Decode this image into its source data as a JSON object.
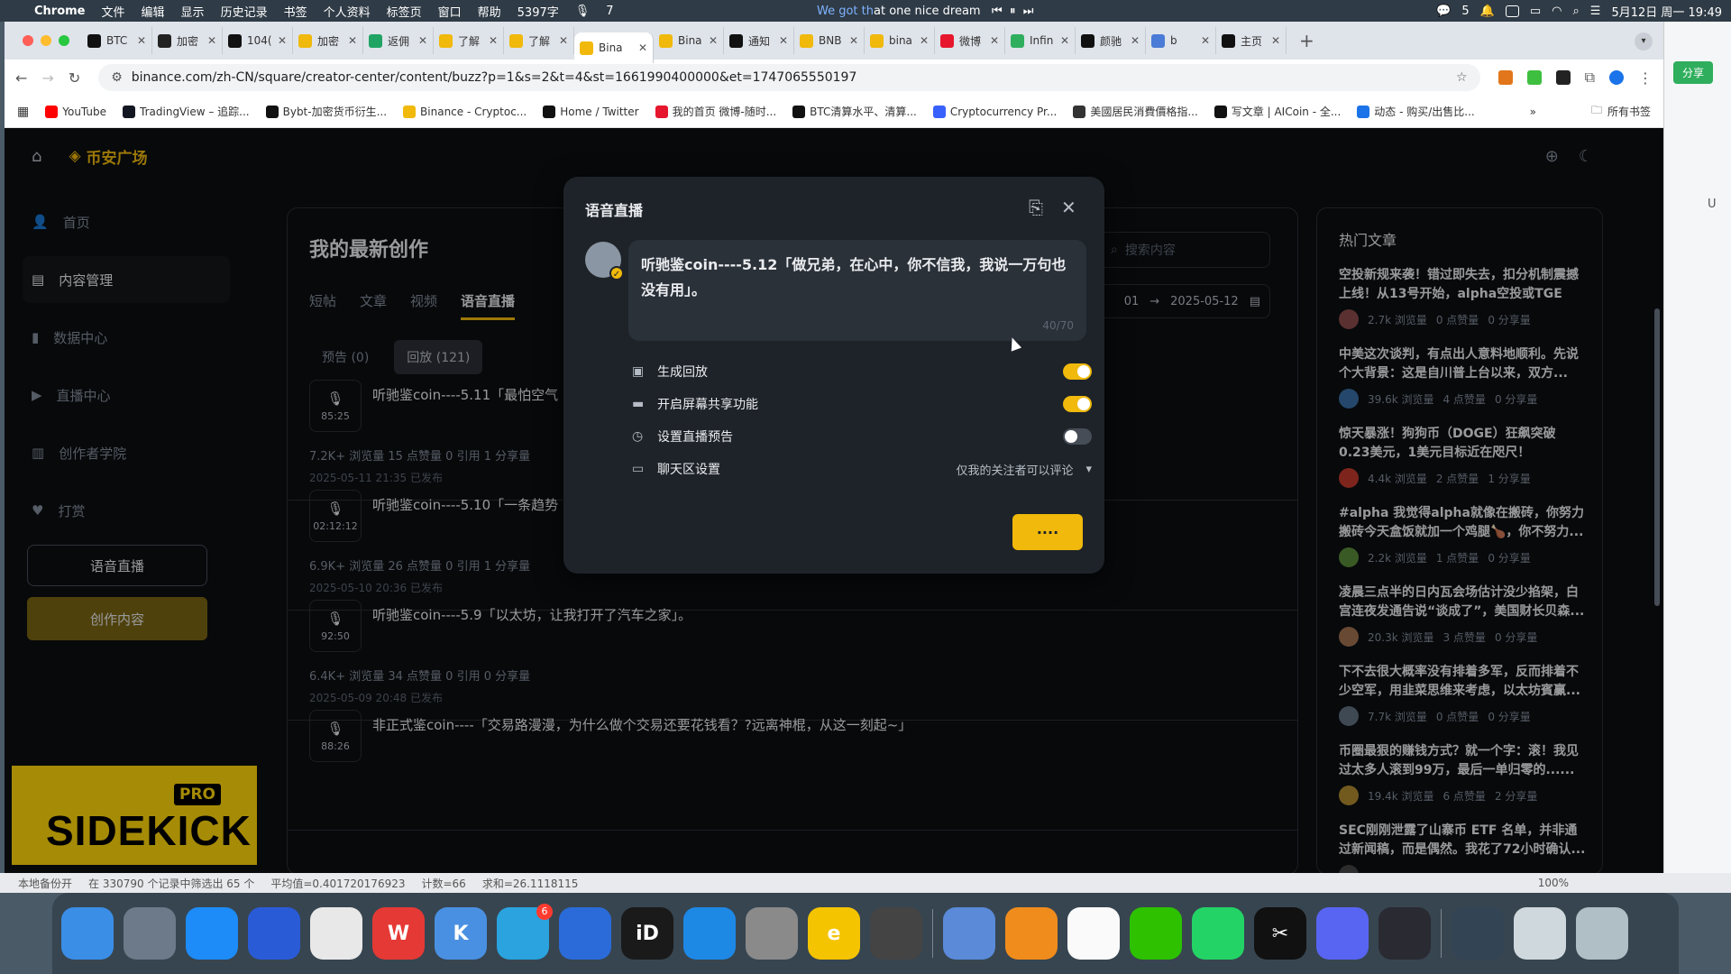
{
  "menubar": {
    "app": "Chrome",
    "items": [
      "文件",
      "编辑",
      "显示",
      "历史记录",
      "书签",
      "个人资料",
      "标签页",
      "窗口",
      "帮助"
    ],
    "word_count": "5397字",
    "badge_count": "7",
    "media_text_a": "We got th",
    "media_text_b": "at one nice dream",
    "wechat_count": "5",
    "datetime": "5月12日 周一 19:49"
  },
  "tabs": [
    {
      "label": "BTC",
      "color": "#111"
    },
    {
      "label": "加密",
      "color": "#222"
    },
    {
      "label": "104(",
      "color": "#111"
    },
    {
      "label": "加密",
      "color": "#f0b90b"
    },
    {
      "label": "返佣",
      "color": "#1fa463"
    },
    {
      "label": "了解",
      "color": "#f0b90b"
    },
    {
      "label": "了解",
      "color": "#f0b90b"
    },
    {
      "label": "Bina",
      "color": "#f0b90b",
      "active": true
    },
    {
      "label": "Bina",
      "color": "#f0b90b"
    },
    {
      "label": "通知",
      "color": "#111"
    },
    {
      "label": "BNB",
      "color": "#f0b90b"
    },
    {
      "label": "bina",
      "color": "#f0b90b"
    },
    {
      "label": "微博",
      "color": "#e6162d"
    },
    {
      "label": "Infin",
      "color": "#2fae5d"
    },
    {
      "label": "颜驰",
      "color": "#111"
    },
    {
      "label": "b",
      "color": "#4a7bd6"
    },
    {
      "label": "主页",
      "color": "#111"
    }
  ],
  "address": {
    "url": "binance.com/zh-CN/square/creator-center/content/buzz?p=1&s=2&t=4&st=1661990400000&et=1747065550197"
  },
  "bookmarks": [
    {
      "label": "YouTube",
      "color": "#ff0000"
    },
    {
      "label": "TradingView – 追踪...",
      "color": "#131722"
    },
    {
      "label": "Bybt-加密货币衍生...",
      "color": "#111"
    },
    {
      "label": "Binance - Cryptoc...",
      "color": "#f0b90b"
    },
    {
      "label": "Home / Twitter",
      "color": "#111"
    },
    {
      "label": "我的首页 微博-随时...",
      "color": "#e6162d"
    },
    {
      "label": "BTC清算水平、清算...",
      "color": "#111"
    },
    {
      "label": "Cryptocurrency Pr...",
      "color": "#3861fb"
    },
    {
      "label": "美國居民消費價格指...",
      "color": "#333"
    },
    {
      "label": "写文章 | AICoin - 全...",
      "color": "#111"
    },
    {
      "label": "动态 - 购买/出售比...",
      "color": "#1a73e8"
    }
  ],
  "bookmarks_all": "所有书签",
  "site": {
    "logo": "币安广场"
  },
  "sidebar": {
    "items": [
      {
        "label": "首页",
        "icon": "user-icon"
      },
      {
        "label": "内容管理",
        "icon": "document-icon",
        "active": true
      },
      {
        "label": "数据中心",
        "icon": "bar-chart-icon"
      },
      {
        "label": "直播中心",
        "icon": "video-icon"
      },
      {
        "label": "创作者学院",
        "icon": "book-icon"
      },
      {
        "label": "打赏",
        "icon": "heart-icon"
      }
    ],
    "voice_live_btn": "语音直播",
    "create_btn": "创作内容"
  },
  "sidekick": {
    "pro": "PRO",
    "name": "SIDEKICK"
  },
  "main": {
    "title": "我的最新创作",
    "tabs": [
      "短帖",
      "文章",
      "视频",
      "语音直播"
    ],
    "search_placeholder": "搜索内容",
    "date_from": "01",
    "date_to": "2025-05-12",
    "subtabs": [
      "预告 (0)",
      "回放 (121)"
    ],
    "items": [
      {
        "duration": "85:25",
        "title": "听驰鉴coin----5.11「最怕空气",
        "stats": "7.2K+ 浏览量   15 点赞量   0 引用   1 分享量",
        "date": "2025-05-11 21:35 已发布"
      },
      {
        "duration": "02:12:12",
        "title": "听驰鉴coin----5.10「一条趋势",
        "stats": "6.9K+ 浏览量   26 点赞量   0 引用   1 分享量",
        "date": "2025-05-10 20:36 已发布"
      },
      {
        "duration": "92:50",
        "title": "听驰鉴coin----5.9「以太坊，让我打开了汽车之家」。",
        "stats": "6.4K+ 浏览量   34 点赞量   0 引用   0 分享量",
        "date": "2025-05-09 20:48 已发布"
      },
      {
        "duration": "88:26",
        "title": "非正式鉴coin----「交易路漫漫，为什么做个交易还要花钱看？?远离神棍，从这一刻起~」",
        "stats": "",
        "date": ""
      }
    ]
  },
  "hot": {
    "title": "热门文章",
    "articles": [
      {
        "title": "空投新规来袭！错过即失去，扣分机制震撼上线！从13号开始，alpha空投或TGE将...",
        "views": "2.7k 浏览量",
        "likes": "0 点赞量",
        "shares": "0 分享量",
        "avatar": "#8a4a4a"
      },
      {
        "title": "中美这次谈判，有点出人意料地顺利。先说个大背景：这是自川普上台以来，双方...",
        "views": "39.6k 浏览量",
        "likes": "4 点赞量",
        "shares": "0 分享量",
        "avatar": "#3a6ea5"
      },
      {
        "title": "惊天暴涨！狗狗币（DOGE）狂飙突破0.23美元，1美元目标近在咫尺！",
        "views": "4.4k 浏览量",
        "likes": "2 点赞量",
        "shares": "1 分享量",
        "avatar": "#c0392b"
      },
      {
        "title": "#alpha 我觉得alpha就像在搬砖，你努力搬砖今天盒饭就加一个鸡腿🍗，你不努力...",
        "views": "2.2k 浏览量",
        "likes": "1 点赞量",
        "shares": "0 分享量",
        "avatar": "#5a8a3a"
      },
      {
        "title": "凌晨三点半的日内瓦会场估计没少掐架，白宫连夜发通告说“谈成了”，美国财长贝森...",
        "views": "20.3k 浏览量",
        "likes": "3 点赞量",
        "shares": "0 分享量",
        "avatar": "#a07050"
      },
      {
        "title": "下不去很大概率没有排着多军，反而排着不少空军，用韭菜思维来考虑，以太坊賓赢...",
        "views": "7.7k 浏览量",
        "likes": "0 点赞量",
        "shares": "0 分享量",
        "avatar": "#607080"
      },
      {
        "title": "币圈最狠的赚钱方式？就一个字：滚！我见过太多人滚到99万，最后一单归零的......",
        "views": "19.4k 浏览量",
        "likes": "6 点赞量",
        "shares": "2 分享量",
        "avatar": "#b08a30"
      },
      {
        "title": "SEC刚刚泄露了山寨币 ETF 名单，并非通过新闻稿，而是偶然。我花了72小时确认...",
        "views": "",
        "likes": "",
        "shares": "",
        "avatar": "#444"
      }
    ]
  },
  "modal": {
    "title": "语音直播",
    "text": "听驰鉴coin----5.12「做兄弟，在心中，你不信我，我说一万句也没有用」。",
    "counter": "40/70",
    "options": [
      {
        "label": "生成回放",
        "icon": "video-camera-icon",
        "on": true
      },
      {
        "label": "开启屏幕共享功能",
        "icon": "monitor-icon",
        "on": true
      },
      {
        "label": "设置直播预告",
        "icon": "clock-icon",
        "on": false
      }
    ],
    "chat_label": "聊天区设置",
    "chat_value": "仅我的关注者可以评论",
    "submit": "····"
  },
  "wps": {
    "share": "分享",
    "u": "U"
  },
  "statusbar": {
    "a": "本地备份开",
    "b": "在 330790 个记录中筛选出 65 个",
    "c": "平均值=0.401720176923",
    "d": "计数=66",
    "e": "求和=26.1118115",
    "zoom": "100%"
  },
  "dock": [
    {
      "name": "finder-icon",
      "color": "#3a8ee6"
    },
    {
      "name": "launchpad-icon",
      "color": "#6c7a89"
    },
    {
      "name": "safari-icon",
      "color": "#1d8cf8"
    },
    {
      "name": "app-icon",
      "color": "#2a5bd7"
    },
    {
      "name": "chrome-icon",
      "color": "#e8e8e8"
    },
    {
      "name": "wps-icon",
      "color": "#e53935"
    },
    {
      "name": "k-icon",
      "color": "#4a90e2"
    },
    {
      "name": "telegram-icon",
      "color": "#2aa3df",
      "badge": "6"
    },
    {
      "name": "app2-icon",
      "color": "#2b6bd9"
    },
    {
      "name": "id-icon",
      "color": "#1a1a1a"
    },
    {
      "name": "appstore-icon",
      "color": "#1e88e5"
    },
    {
      "name": "settings-icon",
      "color": "#8a8a8a"
    },
    {
      "name": "app3-icon",
      "color": "#f5c400"
    },
    {
      "name": "calculator-icon",
      "color": "#444"
    },
    {
      "name": "app4-icon",
      "color": "#5a8ad8"
    },
    {
      "name": "app5-icon",
      "color": "#f08c1c"
    },
    {
      "name": "qq-icon",
      "color": "#fafafa"
    },
    {
      "name": "wechat-icon",
      "color": "#2dc100"
    },
    {
      "name": "app6-icon",
      "color": "#24d366"
    },
    {
      "name": "capcut-icon",
      "color": "#111"
    },
    {
      "name": "discord-icon",
      "color": "#5865f2"
    },
    {
      "name": "obs-icon",
      "color": "#2a2a33"
    },
    {
      "name": "screen-icon",
      "color": "#334455"
    },
    {
      "name": "doc-icon",
      "color": "#cfd8dc"
    },
    {
      "name": "trash-icon",
      "color": "#b0bec5"
    }
  ],
  "dock_labels": {
    "id": "iD",
    "e": "e",
    "wps": "W",
    "k": "K",
    "c": "✂"
  }
}
